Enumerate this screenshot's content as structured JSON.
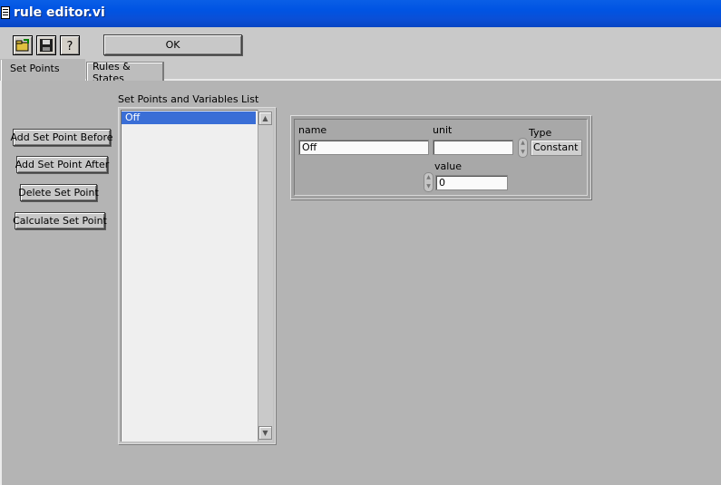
{
  "window": {
    "title": "rule editor.vi"
  },
  "toolbar": {
    "icons": [
      "open-folder-icon",
      "save-disk-icon",
      "help-question-icon"
    ],
    "ok_label": "OK"
  },
  "tabs": [
    {
      "label": "Set Points",
      "selected": true
    },
    {
      "label": "Rules & States",
      "selected": false
    }
  ],
  "actions": {
    "add_before": "Add Set Point Before",
    "add_after": "Add Set Point After",
    "delete": "Delete Set Point",
    "calculate": "Calculate Set Point"
  },
  "list": {
    "label": "Set Points and Variables List",
    "items": [
      {
        "label": "Off",
        "selected": true
      }
    ]
  },
  "cluster": {
    "name_label": "name",
    "name_value": "Off",
    "unit_label": "unit",
    "unit_value": "",
    "type_label": "Type",
    "type_value": "Constant",
    "value_label": "value",
    "value_value": "0"
  },
  "colors": {
    "titlebar": "#0054e3",
    "panel": "#b4b4b4",
    "selection": "#3a6ed6"
  }
}
